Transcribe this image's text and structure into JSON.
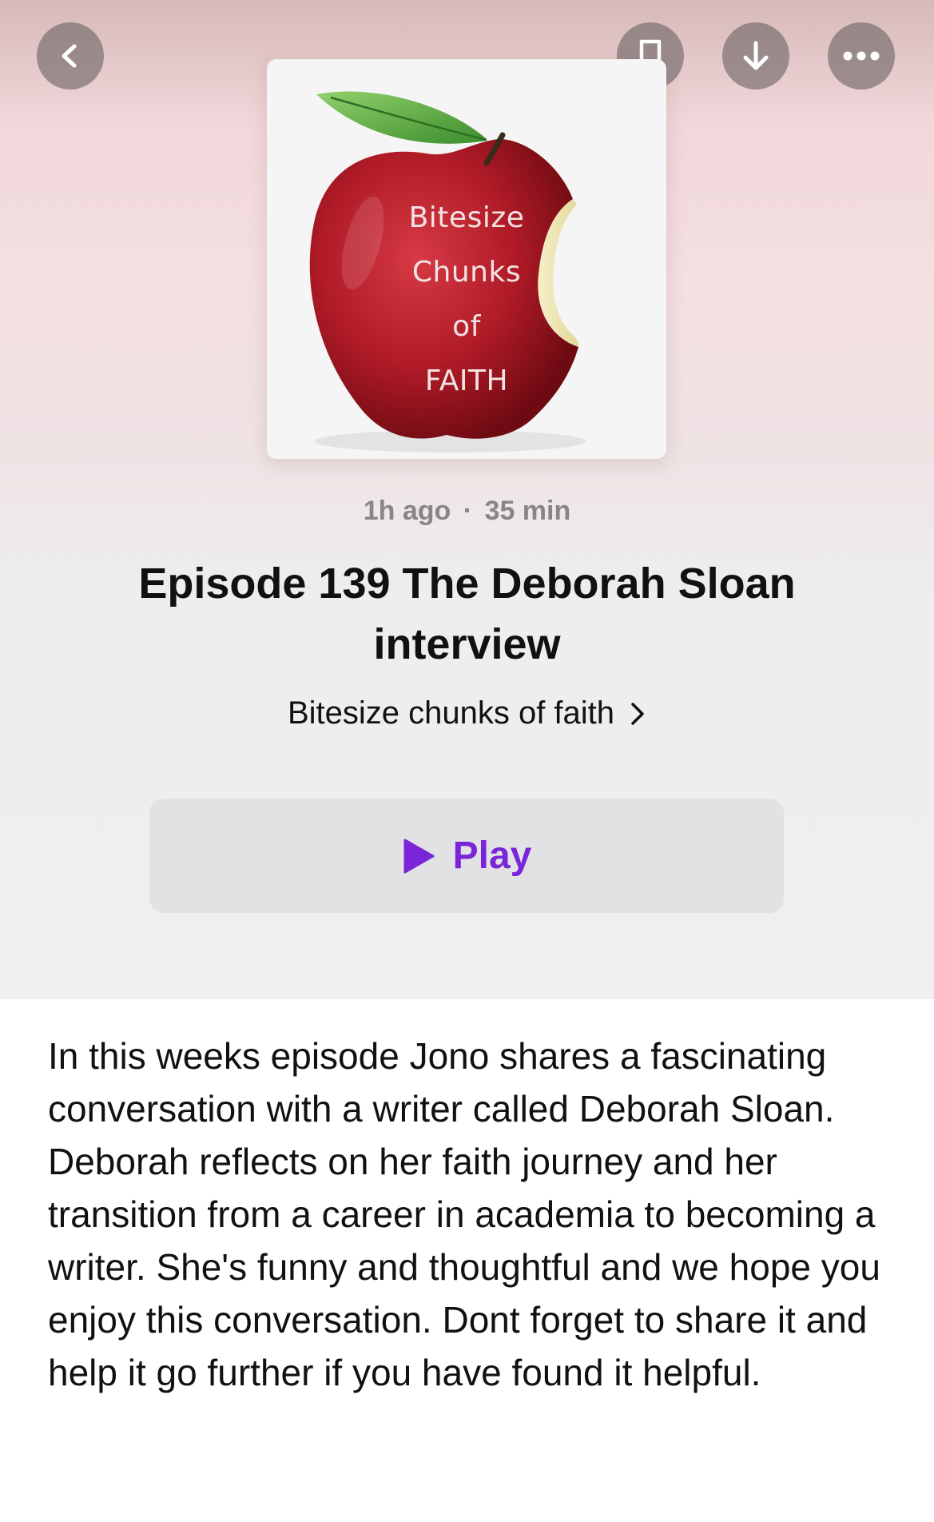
{
  "header": {
    "back_icon": "chevron-left-icon",
    "bookmark_icon": "bookmark-icon",
    "download_icon": "download-arrow-icon",
    "more_icon": "ellipsis-icon"
  },
  "artwork": {
    "line1": "Bitesize",
    "line2": "Chunks",
    "line3": "of",
    "line4": "FAITH"
  },
  "episode": {
    "age": "1h ago",
    "separator": "·",
    "duration": "35 min",
    "title": "Episode 139 The Deborah Sloan interview",
    "show_name": "Bitesize chunks of faith"
  },
  "play_button": {
    "label": "Play",
    "icon": "play-icon",
    "color": "#7a26d8"
  },
  "description": "In this weeks episode Jono shares a fascinating conversation with a writer called Deborah Sloan. Deborah reflects on her faith journey and her transition from a career in academia to becoming a writer. She's funny and thoughtful and we hope you enjoy this conversation. Dont forget to share it and help it go further if you have found it helpful."
}
